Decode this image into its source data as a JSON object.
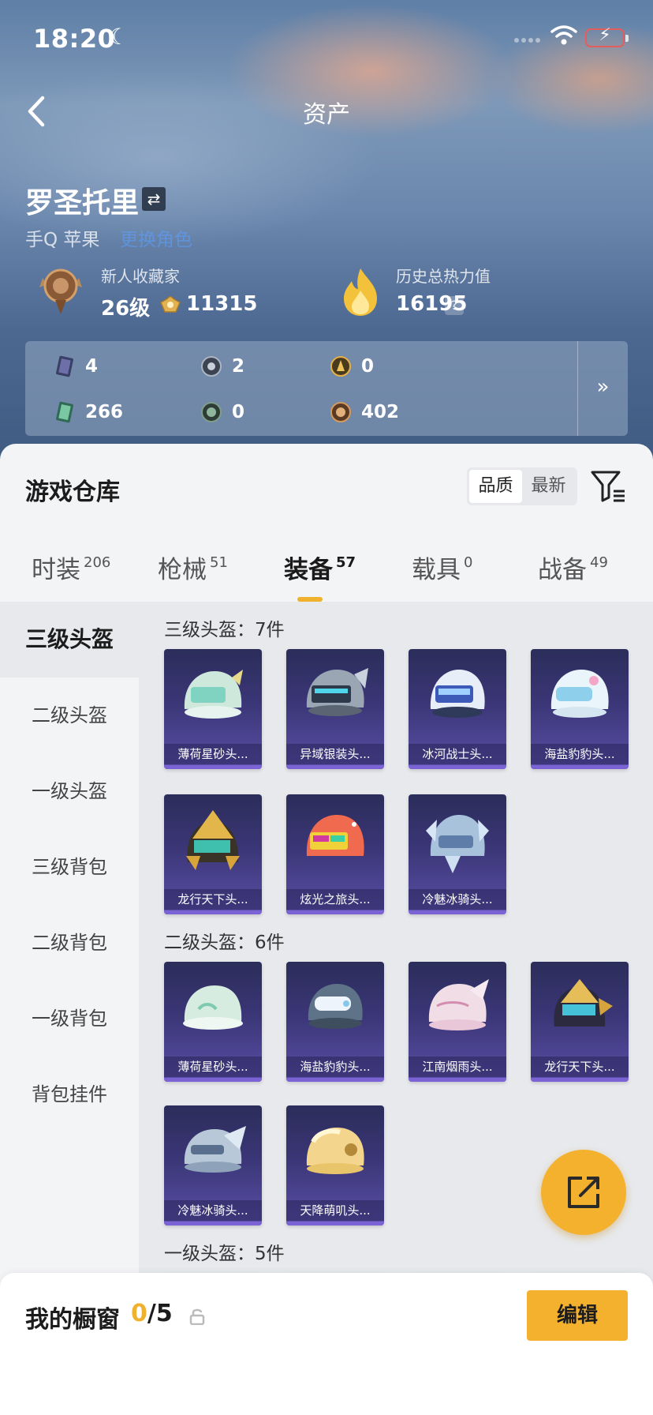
{
  "status_bar": {
    "time": "18:20"
  },
  "nav": {
    "title": "资产"
  },
  "profile": {
    "name": "罗圣托里",
    "platform": "手Q 苹果",
    "link": "更换角色",
    "collector_title": "新人收藏家",
    "level": "26级",
    "collector_points": "11315",
    "heat_label": "历史总热力值",
    "heat_value": "16195",
    "help": "?"
  },
  "currencies": [
    {
      "icon": "purple-card-icon",
      "value": "4"
    },
    {
      "icon": "silver-badge-icon",
      "value": "2"
    },
    {
      "icon": "gold-badge-icon",
      "value": "0"
    },
    {
      "icon": "green-card-icon",
      "value": "266"
    },
    {
      "icon": "green-coin-icon",
      "value": "0"
    },
    {
      "icon": "bronze-coin-icon",
      "value": "402"
    }
  ],
  "warehouse": {
    "title": "游戏仓库",
    "sort_quality": "品质",
    "sort_newest": "最新"
  },
  "tabs": [
    {
      "label": "时装",
      "count": "206"
    },
    {
      "label": "枪械",
      "count": "51"
    },
    {
      "label": "装备",
      "count": "57"
    },
    {
      "label": "载具",
      "count": "0"
    },
    {
      "label": "战备",
      "count": "49"
    }
  ],
  "sidebar": [
    "三级头盔",
    "二级头盔",
    "一级头盔",
    "三级背包",
    "二级背包",
    "一级背包",
    "背包挂件"
  ],
  "sections": [
    {
      "title": "三级头盔：7件",
      "items": [
        "薄荷星砂头...",
        "异域银装头...",
        "冰河战士头...",
        "海盐豹豹头...",
        "龙行天下头...",
        "炫光之旅头...",
        "冷魅冰骑头..."
      ]
    },
    {
      "title": "二级头盔：6件",
      "items": [
        "薄荷星砂头...",
        "海盐豹豹头...",
        "江南烟雨头...",
        "龙行天下头...",
        "冷魅冰骑头...",
        "天降萌叽头..."
      ]
    },
    {
      "title": "一级头盔：5件",
      "items": []
    }
  ],
  "showcase": {
    "title": "我的橱窗",
    "current": "0",
    "total": "/5",
    "edit": "编辑"
  },
  "colors": {
    "accent": "#f4b12e",
    "card_bg": "#3b3677",
    "link": "#5aa0ff"
  }
}
